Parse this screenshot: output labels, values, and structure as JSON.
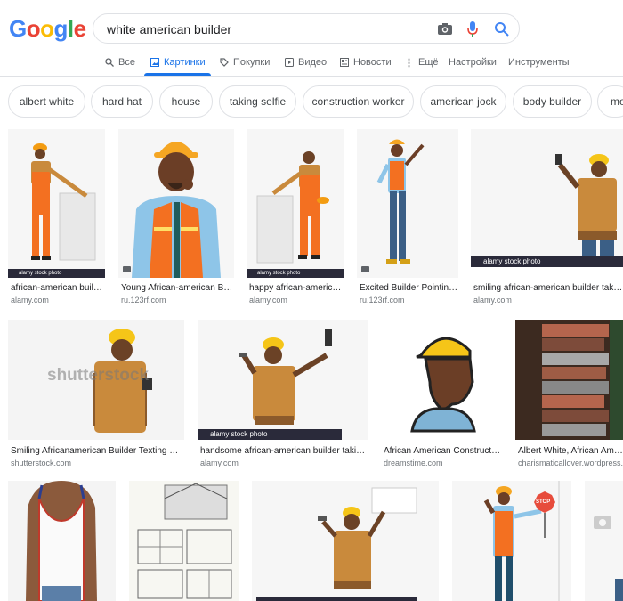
{
  "logo": {
    "letters": [
      "G",
      "o",
      "o",
      "g",
      "l",
      "e"
    ],
    "colors": [
      "#4285f4",
      "#ea4335",
      "#fbbc05",
      "#4285f4",
      "#34a853",
      "#ea4335"
    ]
  },
  "search": {
    "query": "white american builder"
  },
  "tabs": [
    {
      "label": "Все",
      "icon": "search-icon"
    },
    {
      "label": "Картинки",
      "icon": "image-icon",
      "active": true
    },
    {
      "label": "Покупки",
      "icon": "tag-icon"
    },
    {
      "label": "Видео",
      "icon": "play-icon"
    },
    {
      "label": "Новости",
      "icon": "news-icon"
    },
    {
      "label": "Ещё",
      "icon": "more-vert-icon"
    },
    {
      "label": "Настройки"
    },
    {
      "label": "Инструменты"
    }
  ],
  "chips": [
    "albert white",
    "hard hat",
    "house",
    "taking selfie",
    "construction worker",
    "american jock",
    "body builder",
    "mo"
  ],
  "results": {
    "row1": [
      {
        "caption": "african-american build...",
        "source": "alamy.com",
        "badge": "alamy stock photo"
      },
      {
        "caption": "Young African-american Bu...",
        "source": "ru.123rf.com"
      },
      {
        "caption": "happy african-america...",
        "source": "alamy.com",
        "badge": "alamy stock photo"
      },
      {
        "caption": "Excited Builder Pointing...",
        "source": "ru.123rf.com"
      },
      {
        "caption": "smiling african-american builder taking ...",
        "source": "alamy.com",
        "badge": "alamy stock photo"
      }
    ],
    "row2": [
      {
        "caption": "Smiling Africanamerican Builder Texting Me...",
        "source": "shutterstock.com",
        "watermark": "shutterstock"
      },
      {
        "caption": "handsome african-american builder taking...",
        "source": "alamy.com",
        "badge": "alamy stock photo"
      },
      {
        "caption": "African American Constructio...",
        "source": "dreamstime.com"
      },
      {
        "caption": "Albert White, African Americ...",
        "source": "charismaticallover.wordpress.com"
      }
    ]
  },
  "colors": {
    "accent": "#1a73e8",
    "vest": "#f39c12",
    "helmet": "#f5c518",
    "skin": "#6b4226",
    "plaid": "#c98a3c"
  }
}
